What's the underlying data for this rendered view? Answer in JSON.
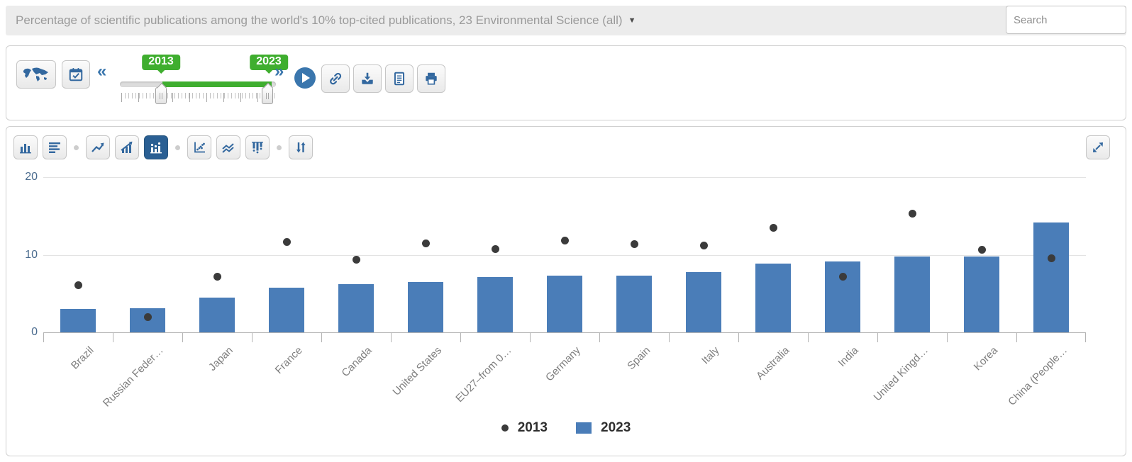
{
  "header": {
    "title": "Percentage of scientific publications among the world's 10% top-cited publications, 23 Environmental Science (all)",
    "dropdown_caret": "▼",
    "search": {
      "placeholder": "Search",
      "value": ""
    }
  },
  "time_toolbar": {
    "step_back": "«",
    "step_forward": "»",
    "start_year_badge": "2013",
    "end_year_badge": "2023",
    "icons": [
      "world-map",
      "calendar-check",
      "play",
      "link",
      "download",
      "document",
      "print"
    ]
  },
  "chart_toolbar": {
    "buttons": [
      "column-chart",
      "row-chart",
      "line-chart",
      "growth-chart",
      "column-dot-chart",
      "scatter-chart",
      "multi-line-chart",
      "drop-bar-chart",
      "sort-toggle",
      "expand"
    ],
    "selected": "column-dot-chart"
  },
  "chart_data": {
    "type": "bar",
    "title": "Percentage of scientific publications among the world's 10% top-cited publications, 23 Environmental Science (all)",
    "categories": [
      "Brazil",
      "Russian Feder…",
      "Japan",
      "France",
      "Canada",
      "United States",
      "EU27–from 0…",
      "Germany",
      "Spain",
      "Italy",
      "Australia",
      "India",
      "United Kingd…",
      "Korea",
      "China (People…"
    ],
    "series": [
      {
        "name": "2013",
        "type": "scatter",
        "marker": "dot",
        "color": "#3b3b3b",
        "values": [
          6.1,
          2.0,
          7.2,
          11.6,
          9.4,
          11.5,
          10.7,
          11.8,
          11.4,
          11.2,
          13.5,
          7.2,
          15.3,
          10.6,
          9.5
        ]
      },
      {
        "name": "2023",
        "type": "bar",
        "marker": "square",
        "color": "#4a7db8",
        "values": [
          3.0,
          3.1,
          4.5,
          5.8,
          6.2,
          6.5,
          7.1,
          7.3,
          7.3,
          7.8,
          8.9,
          9.1,
          9.8,
          9.8,
          14.2
        ]
      }
    ],
    "xlabel": "",
    "ylabel": "",
    "ylim": [
      0,
      20
    ],
    "yticks": [
      0,
      10,
      20
    ],
    "grid": true,
    "legend_position": "bottom-center"
  },
  "legend": {
    "items": [
      {
        "label": "2013",
        "marker": "dot"
      },
      {
        "label": "2023",
        "marker": "square"
      }
    ]
  },
  "colors": {
    "accent_green": "#3fae2f",
    "bar_blue": "#4a7db8",
    "dot_gray": "#3b3b3b",
    "icon_blue": "#33689f",
    "selected_blue": "#2a5f93",
    "title_bar_bg": "#ececec"
  }
}
